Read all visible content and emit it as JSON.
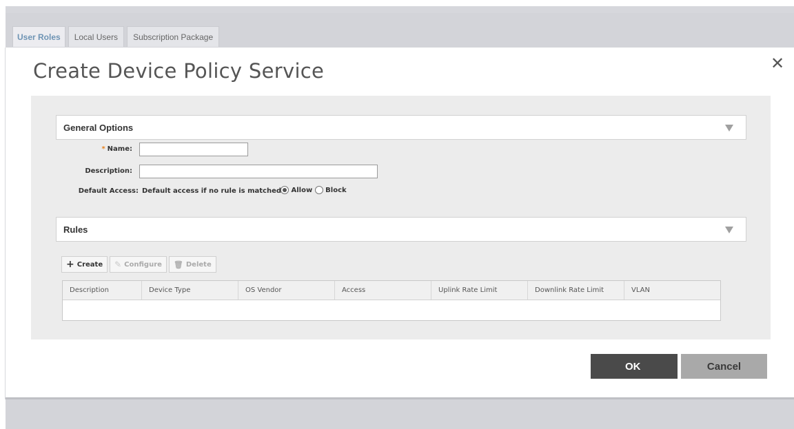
{
  "tabs": [
    {
      "label": "User Roles",
      "active": true
    },
    {
      "label": "Local Users",
      "active": false
    },
    {
      "label": "Subscription Package",
      "active": false
    }
  ],
  "dialog": {
    "title": "Create Device Policy Service",
    "close_icon": "close-icon"
  },
  "general": {
    "header": "General Options",
    "name_label": "Name:",
    "required_mark": "*",
    "name_value": "",
    "description_label": "Description:",
    "description_value": "",
    "default_access_label": "Default Access:",
    "default_access_text": "Default access if no rule is matched:",
    "allow_label": "Allow",
    "block_label": "Block",
    "selected": "Allow"
  },
  "rules": {
    "header": "Rules",
    "toolbar": {
      "create_label": "Create",
      "configure_label": "Configure",
      "delete_label": "Delete"
    },
    "columns": [
      "Description",
      "Device Type",
      "OS Vendor",
      "Access",
      "Uplink Rate Limit",
      "Downlink Rate Limit",
      "VLAN"
    ],
    "rows": []
  },
  "actions": {
    "ok_label": "OK",
    "cancel_label": "Cancel"
  },
  "colors": {
    "active_tab": "#6e94b4",
    "ok_button": "#4a4a4a",
    "cancel_button": "#a9a9a9",
    "required_mark": "#e8821e"
  }
}
